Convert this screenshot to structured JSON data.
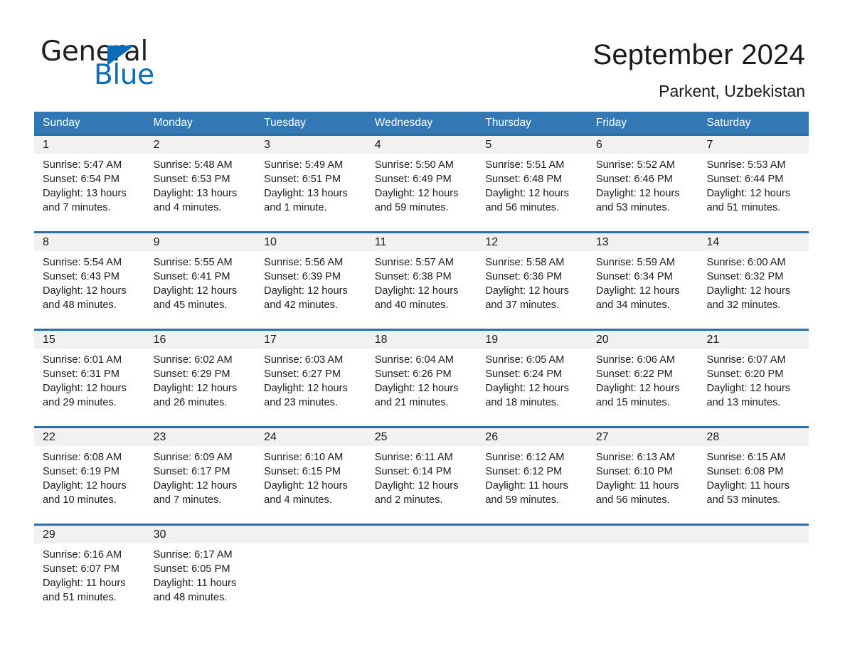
{
  "brand": {
    "name_part1": "General",
    "name_part2": "Blue",
    "triangle_icon": "blue-triangle-icon",
    "accent_color": "#0b6cb7"
  },
  "header": {
    "title": "September 2024",
    "subtitle": "Parkent, Uzbekistan"
  },
  "calendar": {
    "header_bg_color": "#3178b4",
    "row_divider_color": "#2e6da4",
    "daynum_bg_color": "#f1f1f1",
    "weekdays": [
      "Sunday",
      "Monday",
      "Tuesday",
      "Wednesday",
      "Thursday",
      "Friday",
      "Saturday"
    ],
    "weeks": [
      {
        "days": [
          {
            "num": "1",
            "sunrise": "Sunrise: 5:47 AM",
            "sunset": "Sunset: 6:54 PM",
            "daylight1": "Daylight: 13 hours",
            "daylight2": "and 7 minutes."
          },
          {
            "num": "2",
            "sunrise": "Sunrise: 5:48 AM",
            "sunset": "Sunset: 6:53 PM",
            "daylight1": "Daylight: 13 hours",
            "daylight2": "and 4 minutes."
          },
          {
            "num": "3",
            "sunrise": "Sunrise: 5:49 AM",
            "sunset": "Sunset: 6:51 PM",
            "daylight1": "Daylight: 13 hours",
            "daylight2": "and 1 minute."
          },
          {
            "num": "4",
            "sunrise": "Sunrise: 5:50 AM",
            "sunset": "Sunset: 6:49 PM",
            "daylight1": "Daylight: 12 hours",
            "daylight2": "and 59 minutes."
          },
          {
            "num": "5",
            "sunrise": "Sunrise: 5:51 AM",
            "sunset": "Sunset: 6:48 PM",
            "daylight1": "Daylight: 12 hours",
            "daylight2": "and 56 minutes."
          },
          {
            "num": "6",
            "sunrise": "Sunrise: 5:52 AM",
            "sunset": "Sunset: 6:46 PM",
            "daylight1": "Daylight: 12 hours",
            "daylight2": "and 53 minutes."
          },
          {
            "num": "7",
            "sunrise": "Sunrise: 5:53 AM",
            "sunset": "Sunset: 6:44 PM",
            "daylight1": "Daylight: 12 hours",
            "daylight2": "and 51 minutes."
          }
        ]
      },
      {
        "days": [
          {
            "num": "8",
            "sunrise": "Sunrise: 5:54 AM",
            "sunset": "Sunset: 6:43 PM",
            "daylight1": "Daylight: 12 hours",
            "daylight2": "and 48 minutes."
          },
          {
            "num": "9",
            "sunrise": "Sunrise: 5:55 AM",
            "sunset": "Sunset: 6:41 PM",
            "daylight1": "Daylight: 12 hours",
            "daylight2": "and 45 minutes."
          },
          {
            "num": "10",
            "sunrise": "Sunrise: 5:56 AM",
            "sunset": "Sunset: 6:39 PM",
            "daylight1": "Daylight: 12 hours",
            "daylight2": "and 42 minutes."
          },
          {
            "num": "11",
            "sunrise": "Sunrise: 5:57 AM",
            "sunset": "Sunset: 6:38 PM",
            "daylight1": "Daylight: 12 hours",
            "daylight2": "and 40 minutes."
          },
          {
            "num": "12",
            "sunrise": "Sunrise: 5:58 AM",
            "sunset": "Sunset: 6:36 PM",
            "daylight1": "Daylight: 12 hours",
            "daylight2": "and 37 minutes."
          },
          {
            "num": "13",
            "sunrise": "Sunrise: 5:59 AM",
            "sunset": "Sunset: 6:34 PM",
            "daylight1": "Daylight: 12 hours",
            "daylight2": "and 34 minutes."
          },
          {
            "num": "14",
            "sunrise": "Sunrise: 6:00 AM",
            "sunset": "Sunset: 6:32 PM",
            "daylight1": "Daylight: 12 hours",
            "daylight2": "and 32 minutes."
          }
        ]
      },
      {
        "days": [
          {
            "num": "15",
            "sunrise": "Sunrise: 6:01 AM",
            "sunset": "Sunset: 6:31 PM",
            "daylight1": "Daylight: 12 hours",
            "daylight2": "and 29 minutes."
          },
          {
            "num": "16",
            "sunrise": "Sunrise: 6:02 AM",
            "sunset": "Sunset: 6:29 PM",
            "daylight1": "Daylight: 12 hours",
            "daylight2": "and 26 minutes."
          },
          {
            "num": "17",
            "sunrise": "Sunrise: 6:03 AM",
            "sunset": "Sunset: 6:27 PM",
            "daylight1": "Daylight: 12 hours",
            "daylight2": "and 23 minutes."
          },
          {
            "num": "18",
            "sunrise": "Sunrise: 6:04 AM",
            "sunset": "Sunset: 6:26 PM",
            "daylight1": "Daylight: 12 hours",
            "daylight2": "and 21 minutes."
          },
          {
            "num": "19",
            "sunrise": "Sunrise: 6:05 AM",
            "sunset": "Sunset: 6:24 PM",
            "daylight1": "Daylight: 12 hours",
            "daylight2": "and 18 minutes."
          },
          {
            "num": "20",
            "sunrise": "Sunrise: 6:06 AM",
            "sunset": "Sunset: 6:22 PM",
            "daylight1": "Daylight: 12 hours",
            "daylight2": "and 15 minutes."
          },
          {
            "num": "21",
            "sunrise": "Sunrise: 6:07 AM",
            "sunset": "Sunset: 6:20 PM",
            "daylight1": "Daylight: 12 hours",
            "daylight2": "and 13 minutes."
          }
        ]
      },
      {
        "days": [
          {
            "num": "22",
            "sunrise": "Sunrise: 6:08 AM",
            "sunset": "Sunset: 6:19 PM",
            "daylight1": "Daylight: 12 hours",
            "daylight2": "and 10 minutes."
          },
          {
            "num": "23",
            "sunrise": "Sunrise: 6:09 AM",
            "sunset": "Sunset: 6:17 PM",
            "daylight1": "Daylight: 12 hours",
            "daylight2": "and 7 minutes."
          },
          {
            "num": "24",
            "sunrise": "Sunrise: 6:10 AM",
            "sunset": "Sunset: 6:15 PM",
            "daylight1": "Daylight: 12 hours",
            "daylight2": "and 4 minutes."
          },
          {
            "num": "25",
            "sunrise": "Sunrise: 6:11 AM",
            "sunset": "Sunset: 6:14 PM",
            "daylight1": "Daylight: 12 hours",
            "daylight2": "and 2 minutes."
          },
          {
            "num": "26",
            "sunrise": "Sunrise: 6:12 AM",
            "sunset": "Sunset: 6:12 PM",
            "daylight1": "Daylight: 11 hours",
            "daylight2": "and 59 minutes."
          },
          {
            "num": "27",
            "sunrise": "Sunrise: 6:13 AM",
            "sunset": "Sunset: 6:10 PM",
            "daylight1": "Daylight: 11 hours",
            "daylight2": "and 56 minutes."
          },
          {
            "num": "28",
            "sunrise": "Sunrise: 6:15 AM",
            "sunset": "Sunset: 6:08 PM",
            "daylight1": "Daylight: 11 hours",
            "daylight2": "and 53 minutes."
          }
        ]
      },
      {
        "days": [
          {
            "num": "29",
            "sunrise": "Sunrise: 6:16 AM",
            "sunset": "Sunset: 6:07 PM",
            "daylight1": "Daylight: 11 hours",
            "daylight2": "and 51 minutes."
          },
          {
            "num": "30",
            "sunrise": "Sunrise: 6:17 AM",
            "sunset": "Sunset: 6:05 PM",
            "daylight1": "Daylight: 11 hours",
            "daylight2": "and 48 minutes."
          },
          {
            "num": "",
            "sunrise": "",
            "sunset": "",
            "daylight1": "",
            "daylight2": ""
          },
          {
            "num": "",
            "sunrise": "",
            "sunset": "",
            "daylight1": "",
            "daylight2": ""
          },
          {
            "num": "",
            "sunrise": "",
            "sunset": "",
            "daylight1": "",
            "daylight2": ""
          },
          {
            "num": "",
            "sunrise": "",
            "sunset": "",
            "daylight1": "",
            "daylight2": ""
          },
          {
            "num": "",
            "sunrise": "",
            "sunset": "",
            "daylight1": "",
            "daylight2": ""
          }
        ]
      }
    ]
  }
}
